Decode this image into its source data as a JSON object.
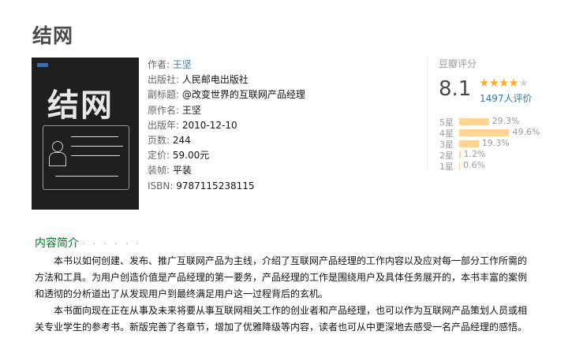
{
  "book": {
    "title": "结网",
    "cover_title": "结网",
    "info": [
      {
        "label": "作者:",
        "value": "王坚",
        "link": true
      },
      {
        "label": "出版社:",
        "value": "人民邮电出版社"
      },
      {
        "label": "副标题:",
        "value": "@改变世界的互联网产品经理"
      },
      {
        "label": "原作名:",
        "value": "王坚"
      },
      {
        "label": "出版年:",
        "value": "2010-12-10"
      },
      {
        "label": "页数:",
        "value": "244"
      },
      {
        "label": "定价:",
        "value": "59.00元"
      },
      {
        "label": "装帧:",
        "value": "平装"
      },
      {
        "label": "ISBN:",
        "value": "9787115238115"
      }
    ]
  },
  "rating": {
    "label": "豆瓣评分",
    "score": "8.1",
    "stars_filled": 4,
    "stars_total": 5,
    "count_text": "1497人评价",
    "colors": {
      "star": "#ffac2d",
      "bar": "#ffd596",
      "link": "#3377aa",
      "section": "#007722"
    },
    "distribution": [
      {
        "label": "5星",
        "percent_text": "29.3%",
        "value": 29.3
      },
      {
        "label": "4星",
        "percent_text": "49.6%",
        "value": 49.6
      },
      {
        "label": "3星",
        "percent_text": "19.3%",
        "value": 19.3
      },
      {
        "label": "2星",
        "percent_text": "1.2%",
        "value": 1.2
      },
      {
        "label": "1星",
        "percent_text": "0.6%",
        "value": 0.6
      }
    ]
  },
  "intro": {
    "heading": "内容简介",
    "dots": "· · · · · ·",
    "paragraphs": [
      "本书以如何创建、发布、推广互联网产品为主线，介绍了互联网产品经理的工作内容以及应对每一部分工作所需的方法和工具。为用户创造价值是产品经理的第一要务，产品经理的工作是围绕用户及具体任务展开的，本书丰富的案例和透彻的分析道出了从发现用户到最终满足用户这一过程背后的玄机。",
      "本书面向现在正在从事及未来将要从事互联网相关工作的创业者和产品经理，也可以作为互联网产品策划人员或相关专业学生的参考书。新版完善了各章节，增加了优雅降级等内容，读者也可从中更深地去感受一名产品经理的感悟。"
    ]
  }
}
